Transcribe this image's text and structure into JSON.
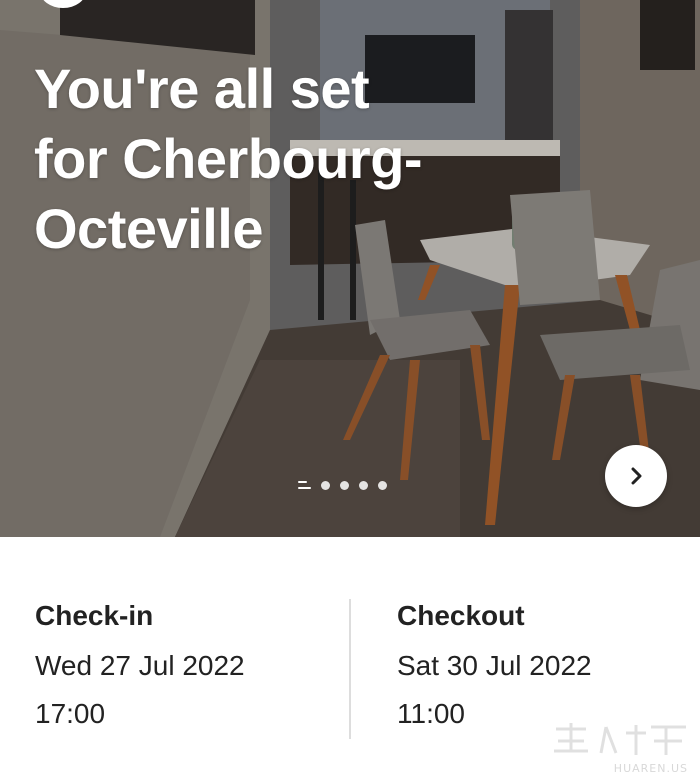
{
  "hero": {
    "title_line1": "You're all set",
    "title_line2": "for Cherbourg-",
    "title_line3": "Octeville",
    "pager": {
      "total": 5,
      "active": 1
    }
  },
  "details": {
    "checkin": {
      "label": "Check-in",
      "date": "Wed 27 Jul 2022",
      "time": "17:00"
    },
    "checkout": {
      "label": "Checkout",
      "date": "Sat 30 Jul 2022",
      "time": "11:00"
    }
  },
  "watermark": {
    "text": "HUAREN.US"
  },
  "icons": {
    "next": "chevron-right-icon",
    "back": "back-icon"
  }
}
